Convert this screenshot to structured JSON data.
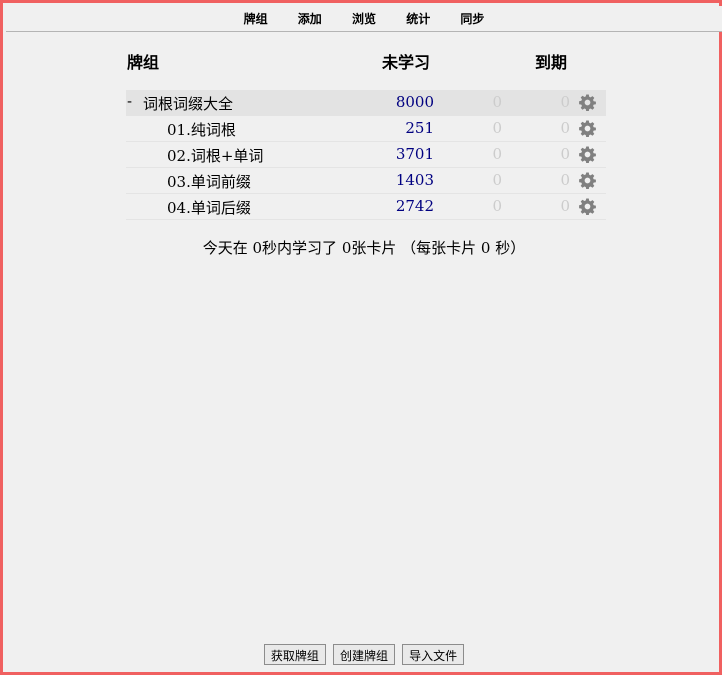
{
  "nav": {
    "decks": "牌组",
    "add": "添加",
    "browse": "浏览",
    "stats": "统计",
    "sync": "同步"
  },
  "table": {
    "header_deck": "牌组",
    "header_new": "未学习",
    "header_due": "到期",
    "rows": [
      {
        "collapse": "-",
        "name": "词根词缀大全",
        "new": "8000",
        "learn": "0",
        "due": "0",
        "current": true
      },
      {
        "name": "01.纯词根",
        "new": "251",
        "learn": "0",
        "due": "0"
      },
      {
        "name": "02.词根+单词",
        "new": "3701",
        "learn": "0",
        "due": "0"
      },
      {
        "name": "03.单词前缀",
        "new": "1403",
        "learn": "0",
        "due": "0"
      },
      {
        "name": "04.单词后缀",
        "new": "2742",
        "learn": "0",
        "due": "0"
      }
    ]
  },
  "stats_text": "今天在 0秒内学习了 0张卡片 （每张卡片 0 秒）",
  "bottom": {
    "get_shared": "获取牌组",
    "create_deck": "创建牌组",
    "import_file": "导入文件"
  },
  "colors": {
    "new_count": "#000080",
    "zero_count": "#cccccc",
    "frame": "#f06060",
    "gear": "#808080"
  }
}
